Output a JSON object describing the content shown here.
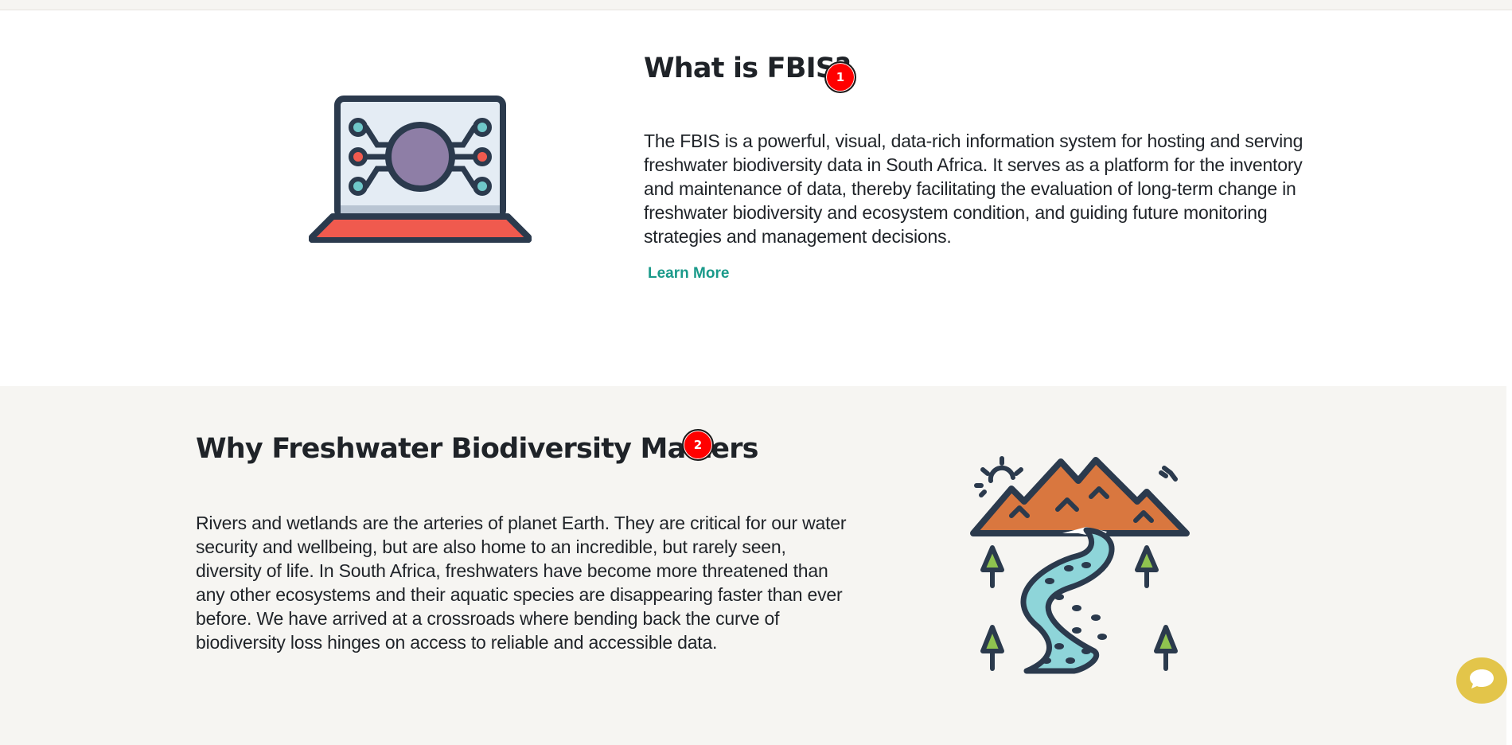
{
  "about": {
    "title": "What is FBIS?",
    "badge": "1",
    "description": "The FBIS is a powerful, visual, data-rich information system for hosting and serving freshwater biodiversity data in South Africa. It serves as a platform for the inventory and maintenance of data, thereby facilitating the evaluation of long-term change in freshwater biodiversity and ecosystem condition, and guiding future monitoring strategies and management decisions.",
    "link_label": "Learn More",
    "icon": "laptop-network-icon"
  },
  "why": {
    "title": "Why Freshwater Biodiversity Matters",
    "badge": "2",
    "description": "Rivers and wetlands are the arteries of planet Earth. They are critical for our water security and wellbeing, but are also home to an incredible, but rarely seen, diversity of life. In South Africa, freshwaters have become more threatened than any other ecosystems and their aquatic species are disappearing faster than ever before. We have arrived at a crossroads where bending back the curve of biodiversity loss hinges on access to reliable and accessible data.",
    "icon": "mountain-river-icon"
  },
  "chat": {
    "icon": "chat-bubble-icon"
  },
  "colors": {
    "accent_link": "#1a9a8a",
    "badge": "#ff0000",
    "chat_button": "#e3c54a",
    "section_grey": "#f6f5f2"
  }
}
